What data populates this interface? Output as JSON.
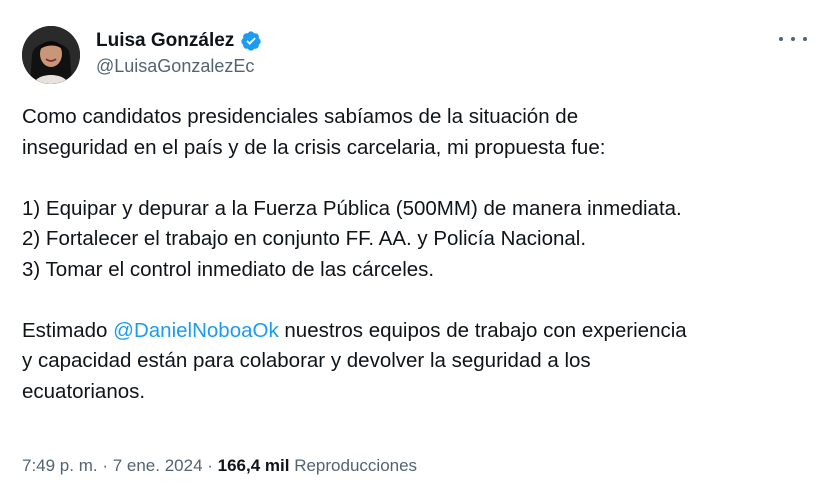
{
  "author": {
    "name": "Luisa González",
    "handle": "@LuisaGonzalezEc",
    "verified_color": "#1d9bf0"
  },
  "icons": {
    "more": "more-horizontal-icon",
    "verified": "verified-badge-icon"
  },
  "tweet": {
    "line1": "Como candidatos presidenciales sabíamos de la situación de",
    "line2": "inseguridad en el país y de la crisis carcelaria, mi propuesta fue:",
    "item1": "1) Equipar y depurar a la Fuerza Pública (500MM) de manera inmediata.",
    "item2": "2) Fortalecer el trabajo en conjunto FF. AA. y Policía Nacional.",
    "item3": "3) Tomar el control inmediato de las cárceles.",
    "closing_prefix": "Estimado ",
    "mention": "@DanielNoboaOk",
    "closing_suffix": " nuestros equipos de trabajo con experiencia",
    "closing_line2": "y capacidad están para colaborar y devolver la seguridad a los",
    "closing_line3": "ecuatorianos."
  },
  "meta": {
    "time": "7:49 p. m.",
    "separator": " · ",
    "date": "7 ene. 2024",
    "views_count": "166,4 mil",
    "views_label": "Reproducciones"
  },
  "colors": {
    "text": "#0f1419",
    "secondary": "#536471",
    "link": "#1d9bf0"
  }
}
